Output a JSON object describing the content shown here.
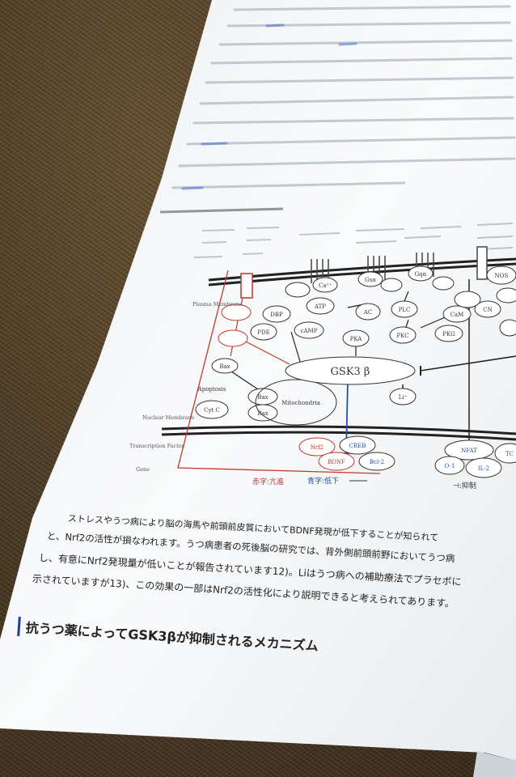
{
  "figure": {
    "title_blurred": "図1",
    "ion_channel": "Ca²⁺ ion",
    "gsk": "GSK3 β",
    "nodes": {
      "ca": "Ca²⁺",
      "atp": "ATP",
      "ac": "AC",
      "plc": "PLC",
      "dbp": "DBP",
      "camp": "cAMP",
      "pde": "PDE",
      "pka": "PKA",
      "pkc": "PKC",
      "pkg": "PKG",
      "cam": "CaM",
      "cn": "CN",
      "nos": "NOS",
      "gsa": "Gsα",
      "gqa": "Gqα",
      "bax1": "Bax",
      "bax2": "Bax",
      "bax3": "Bax",
      "cytc": "Cyt C",
      "apoptosis": "Apoptosis",
      "mito": "Mitochondria",
      "li": "Li⁺",
      "nrf2": "Nrf2",
      "creb": "CREB",
      "bdnf": "BDNF",
      "bcl2": "Bcl-2",
      "nfat": "NFAT",
      "tc": "TC",
      "il2": "IL-2",
      "o1": "O-1"
    },
    "side_labels": {
      "membrane": "Plasma Membrane",
      "nuclear": "Nuclear Membrane",
      "tf": "Transcription Factor",
      "gene": "Gene"
    },
    "legend": {
      "red": "赤字:亢進",
      "blue": "青字:低下",
      "suppress": "⊣:抑制"
    }
  },
  "body": {
    "line1": "ストレスやうつ病により脳の海馬や前頭前皮質においてBDNF発現が低下することが知られて",
    "line2": "と、Nrf2の活性が損なわれます。うつ病患者の死後脳の研究では、背外側前頭前野においてうつ病",
    "line3": "し、有意にNrf2発現量が低いことが報告されています12)。Liはうつ病への補助療法でプラセボに",
    "line4": "示されていますが13)、この効果の一部はNrf2の活性化により説明できると考えられてあります。"
  },
  "section": {
    "heading": "抗うつ薬によってGSK3βが抑制されるメカニズム"
  },
  "colors": {
    "paper": "#f7f8fa",
    "red": "#c0392b",
    "blue": "#1f4fa8",
    "ink": "#333333",
    "heading_blue": "#1f3f8f"
  }
}
